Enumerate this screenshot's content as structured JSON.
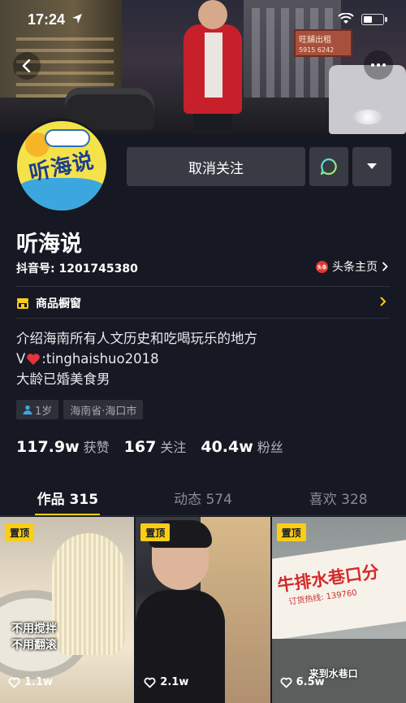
{
  "status_bar": {
    "time": "17:24"
  },
  "header": {
    "banner_sign_text": "旺舖出租",
    "banner_sign_phone": "5915 6242"
  },
  "profile": {
    "avatar_text": "听海说",
    "name": "听海说",
    "douyin_id": "抖音号: 1201745380",
    "toutiao_badge": "头条",
    "toutiao_label": "头条主页",
    "unfollow_label": "取消关注",
    "shop_label": "商品橱窗",
    "bio": {
      "line1": "介绍海南所有人文历史和吃喝玩乐的地方",
      "line2_prefix": "V",
      "line2_suffix": ":tinghaishuo2018",
      "line3": "大龄已婚美食男"
    },
    "tags": {
      "age": "1岁",
      "location": "海南省·海口市"
    },
    "stats": {
      "likes_num": "117.9w",
      "likes_label": "获赞",
      "following_num": "167",
      "following_label": "关注",
      "followers_num": "40.4w",
      "followers_label": "粉丝"
    }
  },
  "tabs": [
    {
      "label": "作品 315"
    },
    {
      "label": "动态 574"
    },
    {
      "label": "喜欢 328"
    }
  ],
  "videos": [
    {
      "pin": "置顶",
      "likes": "1.1w",
      "overlay_line1": "不用搅拌",
      "overlay_line2": "不用翻滚"
    },
    {
      "pin": "置顶",
      "likes": "2.1w"
    },
    {
      "pin": "置顶",
      "likes": "6.5w",
      "sign_text": "牛排水巷口分",
      "sign_phone": "订货热线: 139760",
      "caption": "来到水巷口"
    }
  ],
  "colors": {
    "background": "#161823",
    "accent": "#face15",
    "button": "#393b44"
  }
}
